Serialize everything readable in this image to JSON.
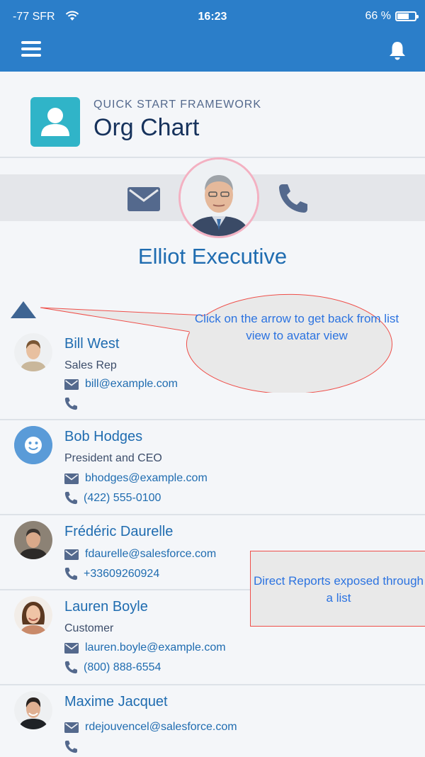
{
  "status_bar": {
    "carrier": "-77 SFR",
    "time": "16:23",
    "battery": "66 %"
  },
  "header": {
    "menu_icon": "menu-icon",
    "bell_icon": "bell-icon"
  },
  "title_area": {
    "kicker": "QUICK START FRAMEWORK",
    "title": "Org Chart",
    "app_icon": "user-icon"
  },
  "hero": {
    "name": "Elliot Executive",
    "email_icon": "email-icon",
    "phone_icon": "phone-icon"
  },
  "colors": {
    "accent": "#2b7ec9",
    "link": "#1f6cb0",
    "icon": "#54698d",
    "app_icon_bg": "#30b4c8",
    "annotation_border": "#ef4f4a"
  },
  "direct_reports": [
    {
      "name": "Bill West",
      "role": "Sales Rep",
      "email": "bill@example.com",
      "phone": ""
    },
    {
      "name": "Bob Hodges",
      "role": "President and CEO",
      "email": "bhodges@example.com",
      "phone": "(422) 555-0100"
    },
    {
      "name": "Frédéric Daurelle",
      "role": "",
      "email": "fdaurelle@salesforce.com",
      "phone": "+33609260924"
    },
    {
      "name": "Lauren Boyle",
      "role": "Customer",
      "email": "lauren.boyle@example.com",
      "phone": "(800) 888-6554"
    },
    {
      "name": "Maxime Jacquet",
      "role": "",
      "email": "rdejouvencel@salesforce.com",
      "phone": ""
    }
  ],
  "annotations": {
    "arrow_callout": "Click on the arrow to get back from list view to avatar view",
    "list_note": "Direct Reports exposed through a list"
  }
}
